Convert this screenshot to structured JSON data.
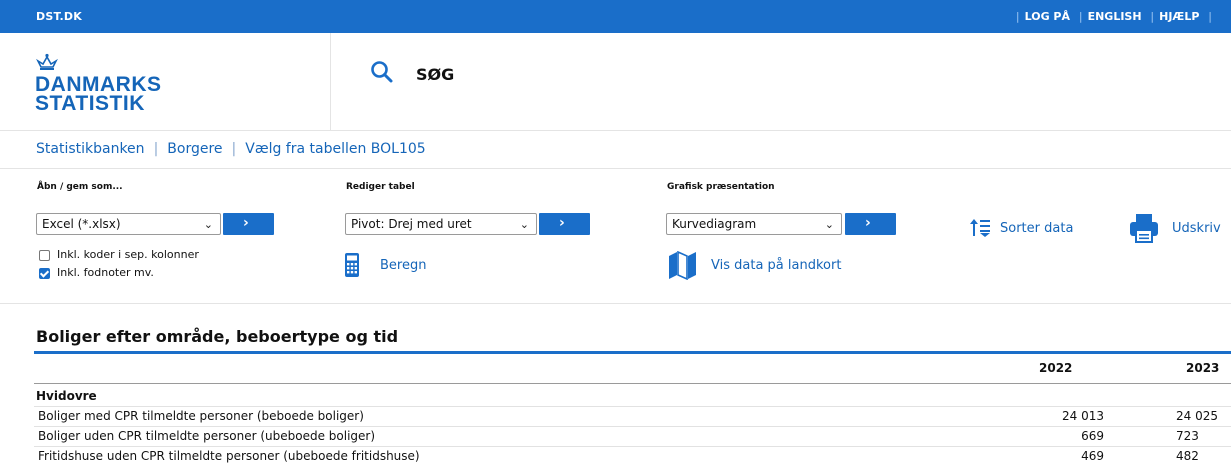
{
  "topbar": {
    "brand": "DST.DK",
    "links": [
      "LOG PÅ",
      "ENGLISH",
      "HJÆLP"
    ]
  },
  "logo": {
    "line1": "DANMARKS",
    "line2": "STATISTIK"
  },
  "search": {
    "label": "SØG"
  },
  "breadcrumb": [
    "Statistikbanken",
    "Borgere",
    "Vælg fra tabellen BOL105"
  ],
  "toolbar": {
    "open_save": {
      "label": "Åbn / gem som...",
      "selected": "Excel (*.xlsx)",
      "go": "›",
      "checkboxes": [
        {
          "label": "Inkl. koder i sep. kolonner",
          "checked": false
        },
        {
          "label": "Inkl. fodnoter mv.",
          "checked": true
        }
      ]
    },
    "edit_table": {
      "label": "Rediger tabel",
      "selected": "Pivot: Drej med uret",
      "go": "›",
      "calc_label": "Beregn"
    },
    "graphic": {
      "label": "Grafisk præsentation",
      "selected": "Kurvediagram",
      "go": "›",
      "map_label": "Vis data på landkort"
    },
    "sort_label": "Sorter data",
    "print_label": "Udskriv"
  },
  "table": {
    "title": "Boliger efter område, beboertype og tid",
    "years": [
      "2022",
      "2023"
    ],
    "region": "Hvidovre",
    "rows": [
      {
        "label": "Boliger med CPR tilmeldte personer (beboede boliger)",
        "values": [
          "24 013",
          "24 025"
        ]
      },
      {
        "label": "Boliger uden CPR tilmeldte personer (ubeboede boliger)",
        "values": [
          "669",
          "723"
        ]
      },
      {
        "label": "Fritidshuse uden CPR tilmeldte personer (ubeboede fritidshuse)",
        "values": [
          "469",
          "482"
        ]
      }
    ]
  },
  "colors": {
    "accent": "#1a6ec9",
    "link": "#1565b8"
  }
}
